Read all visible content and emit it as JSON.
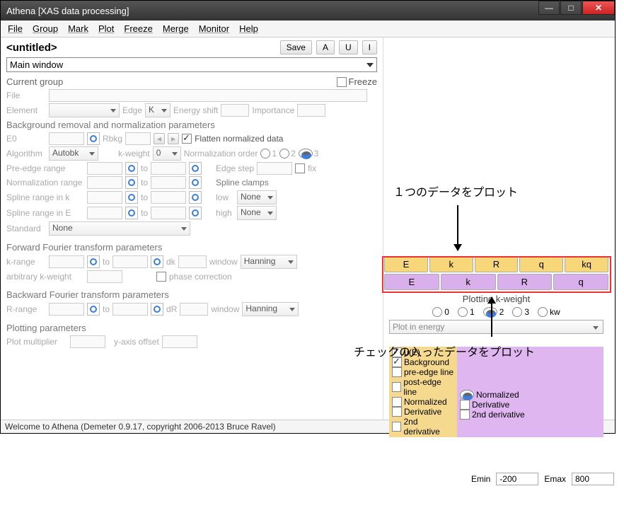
{
  "window": {
    "title": "Athena [XAS data processing]"
  },
  "menubar": [
    "File",
    "Group",
    "Mark",
    "Plot",
    "Freeze",
    "Merge",
    "Monitor",
    "Help"
  ],
  "header": {
    "untitled": "<untitled>",
    "save": "Save",
    "A": "A",
    "U": "U",
    "I": "I",
    "view_selector": "Main window"
  },
  "current_group": {
    "title": "Current group",
    "freeze": "Freeze",
    "file_lbl": "File",
    "element_lbl": "Element",
    "edge_lbl": "Edge",
    "edge_val": "K",
    "eshift_lbl": "Energy shift",
    "importance_lbl": "Importance"
  },
  "bkg": {
    "title": "Background removal and normalization parameters",
    "e0": "E0",
    "rbkg": "Rbkg",
    "flatten": "Flatten normalized data",
    "algorithm_lbl": "Algorithm",
    "algorithm_val": "Autobk",
    "kweight_lbl": "k-weight",
    "kweight_val": "0",
    "norm_order_lbl": "Normalization order",
    "opt1": "1",
    "opt2": "2",
    "opt3": "3",
    "preedge_lbl": "Pre-edge range",
    "to": "to",
    "normrange_lbl": "Normalization range",
    "splinek_lbl": "Spline range in k",
    "splinee_lbl": "Spline range in E",
    "edgestep_lbl": "Edge step",
    "fix": "fix",
    "spline_clamps": "Spline clamps",
    "low": "low",
    "high": "high",
    "none": "None",
    "standard_lbl": "Standard",
    "standard_val": "None"
  },
  "fft": {
    "title": "Forward Fourier transform parameters",
    "krange": "k-range",
    "to": "to",
    "dk": "dk",
    "window": "window",
    "window_val": "Hanning",
    "arbkw": "arbitrary k-weight",
    "phase": "phase correction"
  },
  "bft": {
    "title": "Backward Fourier transform parameters",
    "rrange": "R-range",
    "to": "to",
    "dr": "dR",
    "window": "window",
    "window_val": "Hanning"
  },
  "plotparams": {
    "title": "Plotting parameters",
    "mult": "Plot multiplier",
    "yoff": "y-axis offset"
  },
  "rightpane": {
    "single_buttons": [
      "E",
      "k",
      "R",
      "q",
      "kq"
    ],
    "multi_buttons": [
      "E",
      "k",
      "R",
      "q"
    ],
    "kweight_label": "Plotting k-weight",
    "kw_opts": [
      "0",
      "1",
      "2",
      "3",
      "kw"
    ],
    "plot_in": "Plot in energy",
    "opts_a": [
      "μ(E)",
      "Background",
      "pre-edge line",
      "post-edge line",
      "Normalized",
      "Derivative",
      "2nd derivative"
    ],
    "opts_b": [
      "Normalized",
      "Derivative",
      "2nd derivative"
    ],
    "emin_lbl": "Emin",
    "emin_val": "-200",
    "emax_lbl": "Emax",
    "emax_val": "800"
  },
  "status": "Welcome to Athena (Demeter 0.9.17, copyright 2006-2013 Bruce Ravel)",
  "annotations": {
    "single": "１つのデータをプロット",
    "multi": "チェックの入ったデータをプロット"
  }
}
